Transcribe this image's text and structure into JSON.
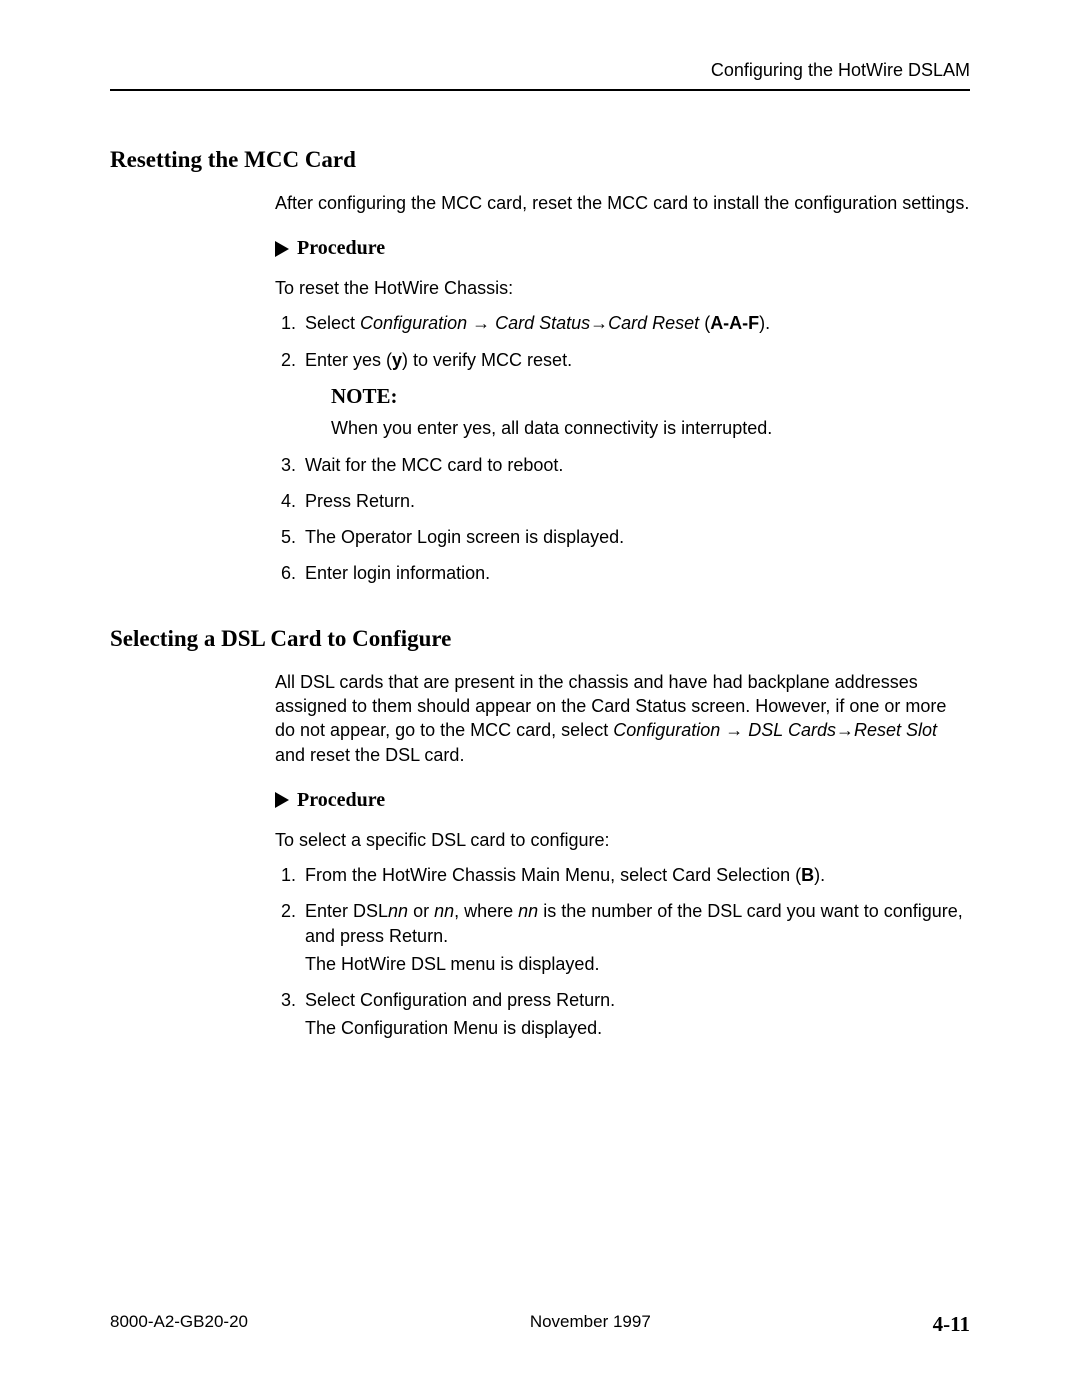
{
  "header": {
    "running_title": "Configuring the HotWire DSLAM"
  },
  "section1": {
    "title": "Resetting the MCC Card",
    "intro": "After configuring the MCC card, reset the MCC card to install the configuration settings.",
    "procedure_label": "Procedure",
    "procedure_intro": "To reset the HotWire Chassis:",
    "step1_prefix": "Select ",
    "step1_menu": "Configuration → Card Status→Card Reset",
    "step1_paren_open": " (",
    "step1_code": "A-A-F",
    "step1_paren_close": ").",
    "step2_prefix": "Enter yes (",
    "step2_bold": "y",
    "step2_suffix": ") to verify MCC reset.",
    "note_title": "NOTE:",
    "note_body": "When you enter yes, all data connectivity is interrupted.",
    "step3": "Wait for the MCC card to reboot.",
    "step4": "Press Return.",
    "step5": "The Operator Login screen is displayed.",
    "step6": "Enter login information."
  },
  "section2": {
    "title": "Selecting a DSL Card to Configure",
    "intro_part1": "All DSL cards that are present in the chassis and have had backplane addresses assigned to them should appear on the Card Status screen. However, if one or more do not appear, go to the MCC card, select ",
    "intro_menu": "Configuration → DSL Cards→Reset Slot",
    "intro_part2": " and reset the DSL card.",
    "procedure_label": "Procedure",
    "procedure_intro": "To select a specific DSL card to configure:",
    "step1_prefix": "From the HotWire Chassis Main Menu, select Card Selection (",
    "step1_bold": "B",
    "step1_suffix": ").",
    "step2_p1": "Enter DSL",
    "step2_nn1": "nn",
    "step2_p2": " or ",
    "step2_nn2": "nn",
    "step2_p3": ", where ",
    "step2_nn3": "nn",
    "step2_p4": " is the number of the DSL card you want to configure, and press Return.",
    "step2_sub": "The HotWire DSL menu is displayed.",
    "step3_main": "Select Configuration and press Return.",
    "step3_sub": "The Configuration Menu is displayed."
  },
  "footer": {
    "doc_id": "8000-A2-GB20-20",
    "date": "November 1997",
    "page": "4-11"
  }
}
